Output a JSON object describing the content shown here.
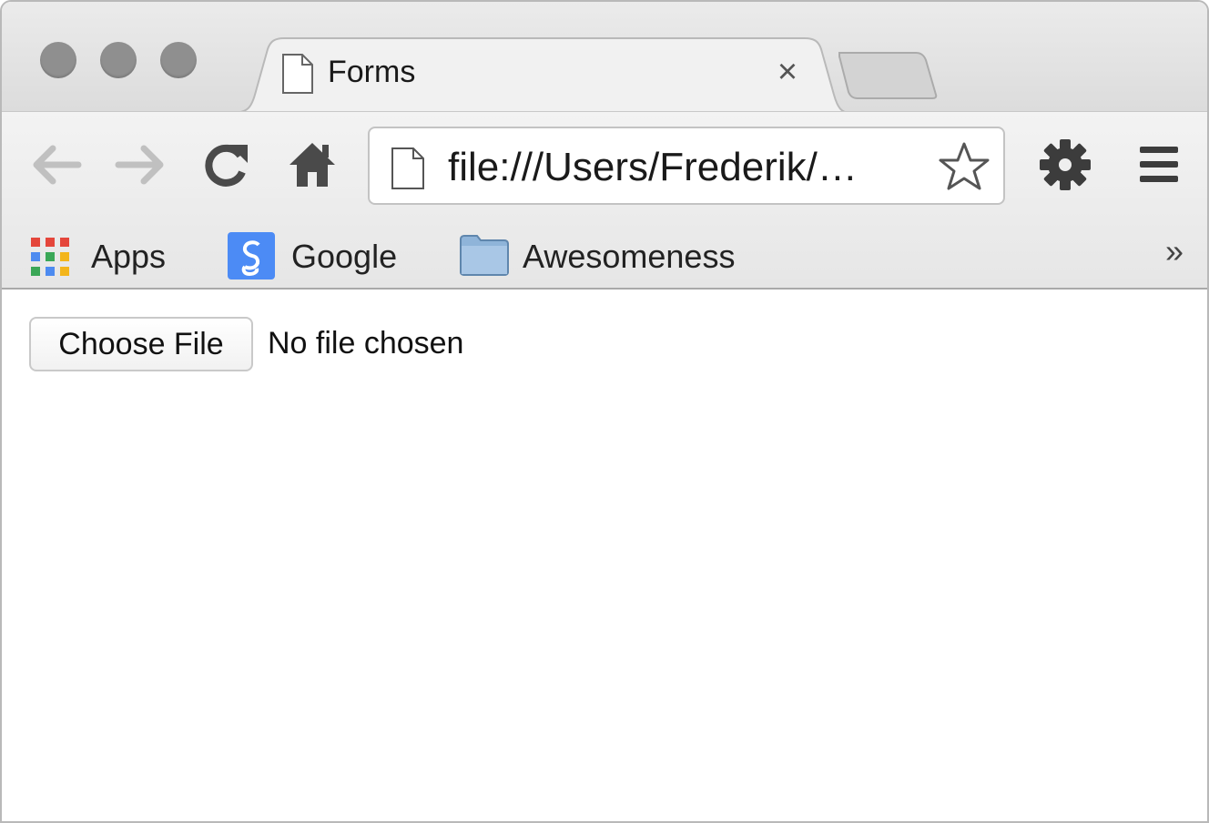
{
  "window": {
    "controls": [
      "close",
      "minimize",
      "zoom"
    ]
  },
  "tab": {
    "title": "Forms",
    "close_label": "×",
    "icon": "page-icon"
  },
  "toolbar": {
    "back_icon": "back-arrow-icon",
    "forward_icon": "forward-arrow-icon",
    "reload_icon": "reload-icon",
    "home_icon": "home-icon",
    "address": "file:///Users/Frederik/…",
    "star_icon": "star-icon",
    "settings_icon": "gear-icon",
    "menu_icon": "hamburger-menu-icon"
  },
  "bookmarks": {
    "items": [
      {
        "label": "Apps",
        "icon": "apps-grid-icon"
      },
      {
        "label": "Google",
        "icon": "google-icon"
      },
      {
        "label": "Awesomeness",
        "icon": "folder-icon"
      }
    ],
    "overflow": "»"
  },
  "content": {
    "file_button_label": "Choose File",
    "file_status": "No file chosen"
  },
  "colors": {
    "chrome_bg": "#e6e6e6",
    "traffic_light": "#8f8f8f",
    "google_blue": "#4c8bf5"
  }
}
